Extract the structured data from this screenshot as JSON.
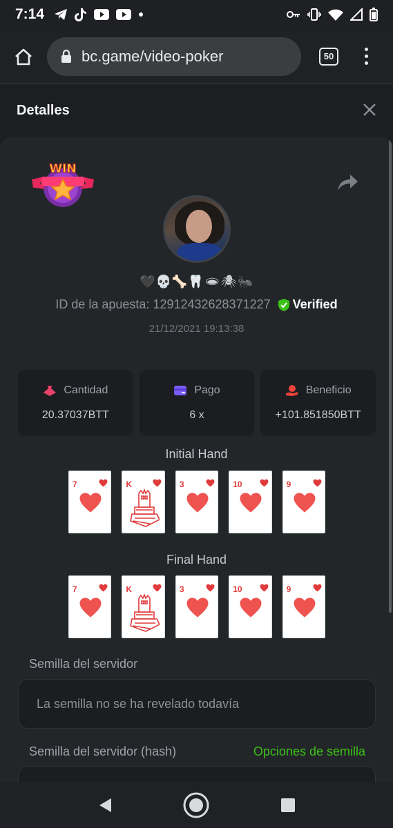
{
  "status": {
    "time": "7:14",
    "left_icons": [
      "telegram-icon",
      "tiktok-icon",
      "youtube-icon",
      "youtube-icon",
      "dot-icon"
    ],
    "right_icons": [
      "key-icon",
      "vibrate-icon",
      "wifi-icon",
      "signal-icon",
      "battery-icon"
    ]
  },
  "browser": {
    "url": "bc.game/video-poker",
    "tab_count": "50"
  },
  "details": {
    "title": "Detalles"
  },
  "bet": {
    "emoji_name": "🖤💀🦴🦷🕳🕷🐜",
    "bet_id": "ID de la apuesta: 12912432628371227",
    "verified": "Verified",
    "date": "21/12/2021 19:13:38"
  },
  "stats": [
    {
      "label": "Cantidad",
      "value": "20.37037BTT",
      "icon": "bet-amount-icon",
      "color": "#e8416a"
    },
    {
      "label": "Pago",
      "value": "6 x",
      "icon": "payout-card-icon",
      "color": "#7b5cf5"
    },
    {
      "label": "Beneficio",
      "value": "+101.851850BTT",
      "icon": "profit-hand-icon",
      "color": "#f0433a"
    }
  ],
  "initial_hand": {
    "title": "Initial Hand",
    "cards": [
      {
        "rank": "7",
        "suit": "hearts"
      },
      {
        "rank": "K",
        "suit": "hearts"
      },
      {
        "rank": "3",
        "suit": "hearts"
      },
      {
        "rank": "10",
        "suit": "hearts"
      },
      {
        "rank": "9",
        "suit": "hearts"
      }
    ]
  },
  "final_hand": {
    "title": "Final Hand",
    "cards": [
      {
        "rank": "7",
        "suit": "hearts"
      },
      {
        "rank": "K",
        "suit": "hearts"
      },
      {
        "rank": "3",
        "suit": "hearts"
      },
      {
        "rank": "10",
        "suit": "hearts"
      },
      {
        "rank": "9",
        "suit": "hearts"
      }
    ]
  },
  "server_seed": {
    "label": "Semilla del servidor",
    "value": "La semilla no se ha revelado todavía"
  },
  "server_seed_hash": {
    "label": "Semilla del servidor (hash)",
    "options_link": "Opciones de semilla"
  },
  "colors": {
    "accent_green": "#3bc117",
    "heart_red": "#e03a3a",
    "panel_bg": "#232629"
  }
}
